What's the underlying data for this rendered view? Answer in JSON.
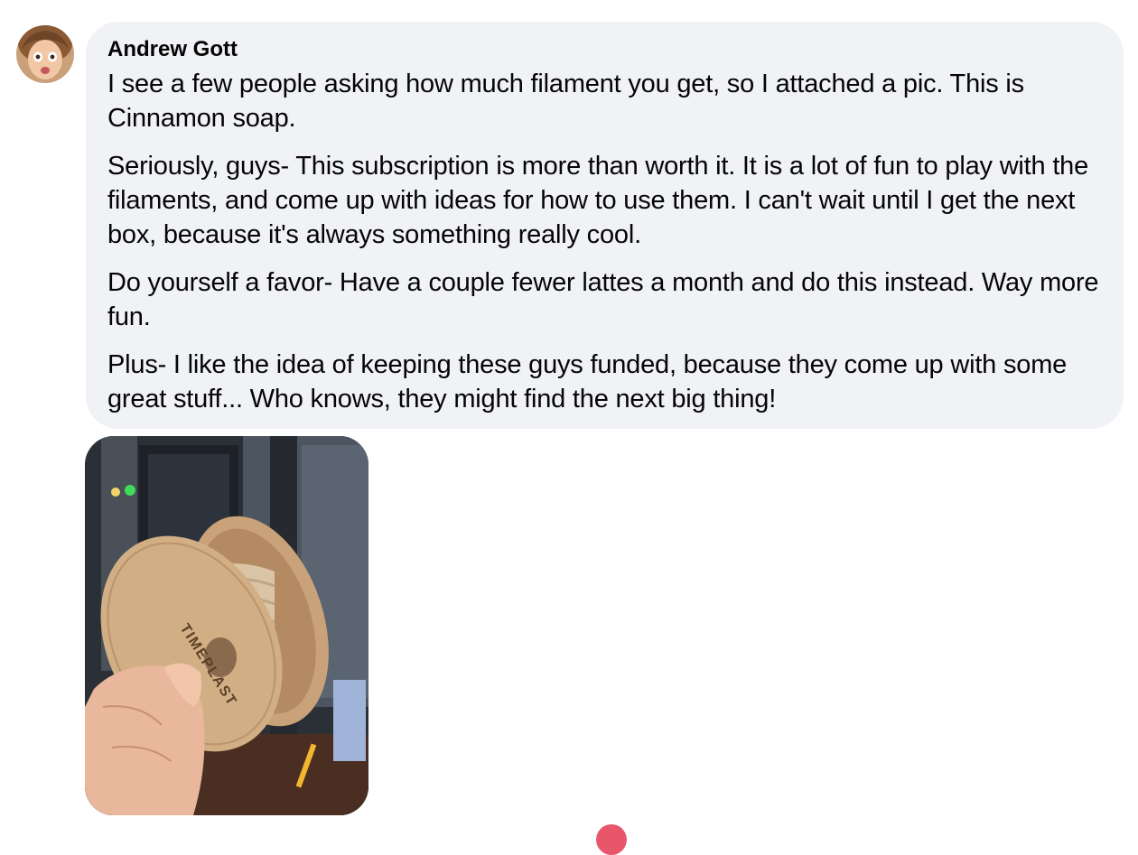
{
  "comment": {
    "author_name": "Andrew Gott",
    "paragraphs": [
      "I see a few people asking how much filament you get, so I attached a pic. This is Cinnamon soap.",
      "Seriously, guys- This subscription is more than worth it. It is a lot of fun to play with the filaments, and come up with ideas for how to use them. I can't wait until I get the next box, because it's always something really cool.",
      "Do yourself a favor- Have a couple fewer lattes a month and do this instead. Way more fun.",
      "Plus- I like the idea of keeping these guys funded, because they come up with some great stuff... Who knows, they might find the next big thing!"
    ],
    "photo": {
      "spool_brand": "TIMEPLAST"
    }
  },
  "colors": {
    "bubble_background": "#f0f2f5",
    "text": "#050505",
    "reaction_accent": "#e8566c"
  },
  "icons": {
    "avatar": "profile-photo",
    "attachment": "filament-spool-photo",
    "reaction": "love-reaction-icon"
  }
}
